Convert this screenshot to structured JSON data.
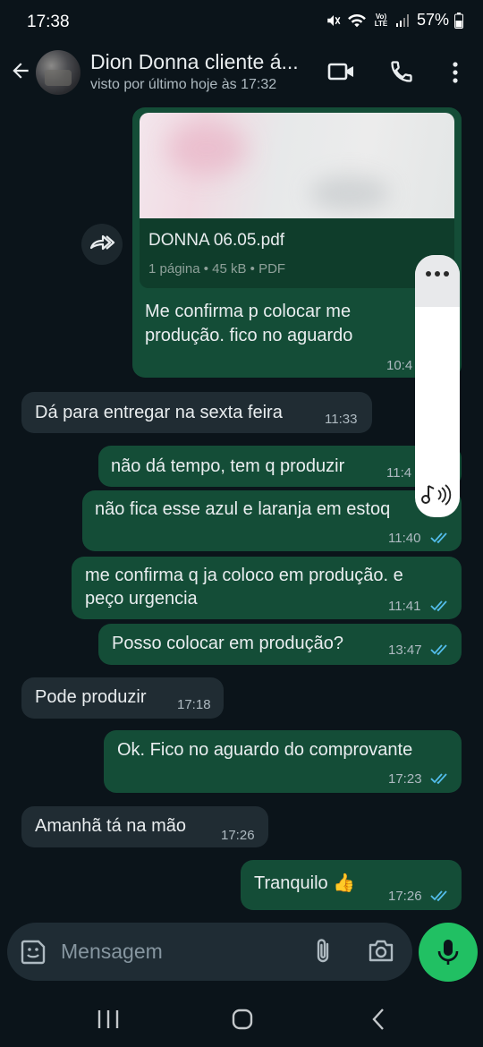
{
  "status_bar": {
    "time": "17:38",
    "battery": "57%",
    "network": "Vo) LTE"
  },
  "header": {
    "contact_name": "Dion Donna cliente á...",
    "last_seen": "visto por último hoje às 17:32"
  },
  "messages": [
    {
      "type": "document",
      "direction": "out",
      "file_name": "DONNA 06.05.pdf",
      "file_meta": "1 página • 45 kB • PDF",
      "text_lines": [
        "Me confirma p colocar me",
        "produção. fico no aguardo"
      ],
      "time": "10:4"
    },
    {
      "type": "text",
      "direction": "in",
      "text": "Dá para entregar na sexta feira",
      "time": "11:33"
    },
    {
      "type": "text",
      "direction": "out",
      "text": "não dá tempo,  tem q produzir",
      "time": "11:4"
    },
    {
      "type": "text",
      "direction": "out",
      "text": "não fica esse azul e laranja em estoq",
      "time": "11:40"
    },
    {
      "type": "text",
      "direction": "out",
      "text_lines": [
        "me confirma q ja coloco em produção. e",
        "peço urgencia"
      ],
      "time": "11:41"
    },
    {
      "type": "text",
      "direction": "out",
      "text": "Posso colocar  em produção?",
      "time": "13:47"
    },
    {
      "type": "text",
      "direction": "in",
      "text": "Pode produzir",
      "time": "17:18"
    },
    {
      "type": "text",
      "direction": "out",
      "text": "Ok. Fico no aguardo do comprovante",
      "time": "17:23"
    },
    {
      "type": "text",
      "direction": "in",
      "text": "Amanhã tá na mão",
      "time": "17:26"
    },
    {
      "type": "text",
      "direction": "out",
      "text": "Tranquilo 👍",
      "time": "17:26"
    }
  ],
  "input": {
    "placeholder": "Mensagem"
  },
  "colors": {
    "outgoing_bubble": "#144d37",
    "incoming_bubble": "#202c33",
    "background": "#0b141a",
    "accent": "#21c063",
    "read_ticks": "#53bdeb"
  },
  "icons": [
    "back-arrow-icon",
    "video-call-icon",
    "phone-icon",
    "more-vert-icon",
    "forward-icon",
    "more-horiz-icon",
    "audio-icon",
    "emoji-icon",
    "attach-icon",
    "camera-icon",
    "mic-icon"
  ]
}
